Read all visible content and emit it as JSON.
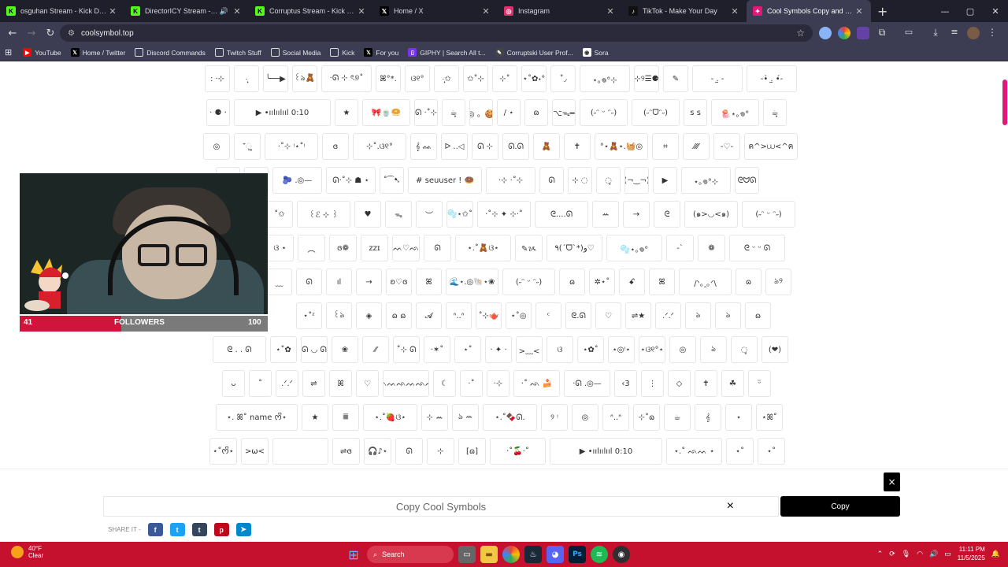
{
  "browser": {
    "tabs": [
      {
        "title": "osguhan Stream - Kick Dashbo...",
        "icon": "kick-icon",
        "fav_color": "#53fc18",
        "fav_glyph": "K",
        "active": false,
        "audio": false
      },
      {
        "title": "DirectorICY Stream - Watch",
        "icon": "kick-icon",
        "fav_color": "#53fc18",
        "fav_glyph": "K",
        "active": false,
        "audio": true
      },
      {
        "title": "Corruptus Stream - Kick Dashb...",
        "icon": "kick-icon",
        "fav_color": "#53fc18",
        "fav_glyph": "K",
        "active": false,
        "audio": false
      },
      {
        "title": "Home / X",
        "icon": "x-icon",
        "fav_color": "#000000",
        "fav_glyph": "𝕏",
        "active": false,
        "audio": false
      },
      {
        "title": "Instagram",
        "icon": "instagram-icon",
        "fav_color": "#e1306c",
        "fav_glyph": "◎",
        "active": false,
        "audio": false
      },
      {
        "title": "TikTok - Make Your Day",
        "icon": "tiktok-icon",
        "fav_color": "#111111",
        "fav_glyph": "♪",
        "active": false,
        "audio": false
      },
      {
        "title": "Cool Symbols Copy and Paste",
        "icon": "coolsymbol-icon",
        "fav_color": "#e0187a",
        "fav_glyph": "✦",
        "active": true,
        "audio": false
      }
    ],
    "new_tab": "+",
    "url": "coolsymbol.top",
    "bookmarks": [
      {
        "label": "YouTube",
        "icon": "youtube-icon",
        "color": "#ff0000",
        "glyph": "▶"
      },
      {
        "label": "Home / Twitter",
        "icon": "x-icon",
        "color": "#000000",
        "glyph": "𝕏"
      },
      {
        "label": "Discord Commands",
        "icon": "folder-icon",
        "color": "#3c3c52",
        "glyph": "▭"
      },
      {
        "label": "Twitch Stuff",
        "icon": "folder-icon",
        "color": "#3c3c52",
        "glyph": "▭"
      },
      {
        "label": "Social Media",
        "icon": "folder-icon",
        "color": "#3c3c52",
        "glyph": "▭"
      },
      {
        "label": "Kick",
        "icon": "folder-icon",
        "color": "#3c3c52",
        "glyph": "▭"
      },
      {
        "label": "For you",
        "icon": "x-icon",
        "color": "#000000",
        "glyph": "𝕏"
      },
      {
        "label": "GIPHY | Search All t...",
        "icon": "giphy-icon",
        "color": "#7b2ff7",
        "glyph": "▯"
      },
      {
        "label": "Corruptski User Prof...",
        "icon": "pen-icon",
        "color": "#444444",
        "glyph": "✎"
      },
      {
        "label": "Sora",
        "icon": "sora-icon",
        "color": "#ffffff",
        "glyph": "◉"
      }
    ]
  },
  "symbols": [
    [
      ": ·⊹",
      "·̩͙",
      "╰──▶",
      "꒰ঌ🧸",
      "·ᘏ ⊹ ৎ୭˚",
      "ꕤ°*.",
      "ଓ୧°",
      "·̩͙✩",
      "✩˚⊹",
      "⊹˚",
      "⋆˚✿˖°",
      "˚◞",
      "⋆｡𖦹°⊹",
      "⊹୨☰⚈",
      "✎",
      "- .̫ -",
      "-•̀ .̫ •́-"
    ],
    [
      "· ⚈ ·",
      "▶ •ıılıılııl 0:10",
      "★",
      "🎀🍵🥯",
      "ᘏ ·˚⊹",
      "☕̥",
      "◎ 。🍪",
      "/ ⋆",
      "ɷ",
      "⌥ᯓ━",
      "(˶ᵔ ᵕ ᵔ˶)",
      "(˶ᵔᗜᵔ˶)",
      "ꜱ ꜱ",
      "🪼⋆｡𖦹°",
      "☕̥"
    ],
    [
      "◎",
      "⁺ૢ",
      "·˚⊹ ᵎ⋆˚ᵎ",
      "ɞ",
      "⊹˚.ଓ୧°",
      "𝄞 ᨐ",
      "ᐅ ..◁",
      "ᘏ ⊹",
      "ᘏ.ᘏ",
      "🧸",
      "✝",
      "°⋆🧸⋆.🧺◎",
      "⌗",
      "⁄⁄⁄⁄",
      "-♡-",
      "ฅ^>⩊<^ฅ"
    ],
    [
      "♡",
      "♢",
      "🫐 .◎—",
      "ᘏ·˚⊹ ☗ ⋆",
      "˚⁀➷",
      "# seuuser ! 🍩",
      "·⊹ ·˚⊹",
      "ᘏ",
      "⊹ ◌",
      "◌̥",
      "(¬‿¬)",
      "▶",
      "⋆｡𖦹°⊹",
      "ᘓᗢᘏ"
    ],
    [
      "˚✩",
      "꒰ℰ ⊹ ꒱",
      "♥",
      "ᯓ",
      "︶",
      "🫧⋆✩˚",
      "·˚⊹ ✦ ⊹·˚",
      "ᘓ....ᘏ",
      "ꕀ",
      "→",
      "ᘓ",
      "(๑>◡<๑)",
      "(˶ᵔ ᵕ ᵔ˶)"
    ],
    [
      "ଓ ⋆",
      "︵",
      "ɞ❁",
      "zzɪ",
      "ᨒᨓ♡ᨒᨓ",
      "ᘏ",
      "⋆.˚🧸ଓ⋆",
      "✎ᝰ",
      "٩(ˊᗜˋ*)و♡",
      "🫧⋆｡𖦹°",
      "-ˋ",
      "❁",
      "ᘓ ᵕ ᵕ ᘏ"
    ],
    [
      "﹏",
      "ᘏ",
      "ıl",
      "→",
      "ʚ♡ɞ",
      "ꕤ",
      "🌊⋆.◎🐚⋆❀",
      "(˶ᵔ ᵕ ᵔ˶)",
      "ɷ",
      "✲⋆˚",
      "ꗃ",
      "ꕤ",
      "/ᐠ｡ꞈ｡ᐟ\\",
      "ɷ",
      "ঌ୨"
    ],
    [
      "⋆˚ᶻ",
      "꒰ঌ",
      "◈",
      "ɷ ɷ",
      "𝓐",
      "ᐢ..ᐢ",
      "˚⊹🫖",
      "⋆˚◎",
      "ᶜ",
      "ᘓ.ᘏ",
      "♡",
      "⇌★",
      ".ᐟ.ᐟ",
      "ঌ",
      "ঌ",
      "ɷ"
    ],
    [
      "ᘓ . . ᘏ",
      "⋆˚✿",
      "ᘏ ◡ ᘏ",
      "❀",
      "⁄⁄",
      "˚⊹ ᘏ",
      "·✶˚",
      "⋆˚",
      "· ✦ ·",
      ">﹏<",
      "ଓ",
      "⋆✿˚",
      "⋆◎ᵎ⋆",
      "⋆ଓ୧°⋆",
      "◎",
      "ঌ",
      "◌̥",
      "(❤)"
    ],
    [
      "ᴗ",
      "˚",
      ".ᐟ.ᐟ",
      "⇌",
      "ꕤ",
      "♡",
      "ᨒᨓᨒᨓᨒᨓ",
      "☾",
      "·˚",
      "·⊹",
      "·˚ ᨒ 🍰",
      "·ᘏ .◎—",
      "‹3",
      "⋮",
      "◇",
      "✝",
      "☘︎",
      "ᵕ̈"
    ],
    [
      "⋆. ꕤ˚ name ᰔᩚ⋆",
      "★",
      "𝄜",
      "⋆.˚🍓ଓ⋆",
      "⊹ ꕀ",
      "ঌ ꕀ",
      "⋆.˚🍫ᘏ.",
      "୨ ᵎ",
      "◎",
      "ᐢ..ᐢ",
      "⊹˚ɷ",
      "☕",
      "𝄞",
      "⋆",
      "⋆ꕤ˚"
    ],
    [
      "⋆˚ᰔᩚ⋆",
      ">ω<",
      "",
      "⇌ɞ",
      "🎧♪⋆",
      "ᘏ",
      "⊹",
      "[ɷ]",
      "·˚🍒·˚",
      "▶ •ıılıılııl 0:10",
      "⋆.˚ ᨒᨓ ⋆",
      "⋆˚",
      "⋆˚"
    ]
  ],
  "webcam": {
    "followers_current": "41",
    "followers_label": "FOLLOWERS",
    "followers_goal": "100",
    "followers_progress": 0.41
  },
  "copy_panel": {
    "close_label": "×",
    "input_placeholder": "Copy Cool Symbols",
    "clear_label": "×",
    "copy_button": "Copy",
    "share_label": "SHARE IT -",
    "share_buttons": [
      {
        "name": "facebook-share-icon",
        "color": "#3b5998",
        "glyph": "f"
      },
      {
        "name": "twitter-share-icon",
        "color": "#1da1f2",
        "glyph": "t"
      },
      {
        "name": "tumblr-share-icon",
        "color": "#35465c",
        "glyph": "t"
      },
      {
        "name": "pinterest-share-icon",
        "color": "#bd081c",
        "glyph": "p"
      },
      {
        "name": "telegram-share-icon",
        "color": "#0088cc",
        "glyph": "➤"
      }
    ]
  },
  "taskbar": {
    "weather_temp": "40°F",
    "weather_desc": "Clear",
    "search_label": "Search",
    "time": "11:11 PM",
    "date": "11/5/2025",
    "accent": "#c5112d"
  }
}
